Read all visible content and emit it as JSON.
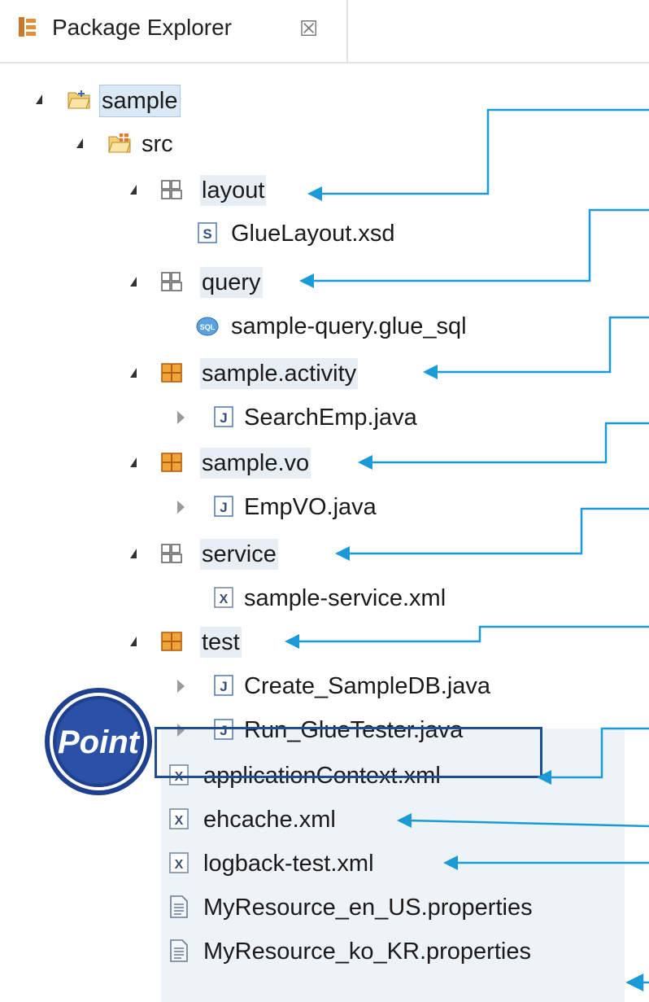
{
  "panel": {
    "title": "Package Explorer",
    "close_glyph": "☒"
  },
  "tree": [
    {
      "label": "sample",
      "icon": "project-folder-icon",
      "toggle": "open"
    },
    {
      "label": "src",
      "icon": "source-folder-icon",
      "toggle": "open"
    },
    {
      "label": "layout",
      "icon": "empty-package-icon",
      "toggle": "open"
    },
    {
      "label": "GlueLayout.xsd",
      "icon": "xsd-file-icon",
      "toggle": "none"
    },
    {
      "label": "query",
      "icon": "empty-package-icon",
      "toggle": "open"
    },
    {
      "label": "sample-query.glue_sql",
      "icon": "sql-file-icon",
      "toggle": "none"
    },
    {
      "label": "sample.activity",
      "icon": "package-icon",
      "toggle": "open"
    },
    {
      "label": "SearchEmp.java",
      "icon": "java-file-icon",
      "toggle": "closed"
    },
    {
      "label": "sample.vo",
      "icon": "package-icon",
      "toggle": "open"
    },
    {
      "label": "EmpVO.java",
      "icon": "java-file-icon",
      "toggle": "closed"
    },
    {
      "label": "service",
      "icon": "empty-package-icon",
      "toggle": "open"
    },
    {
      "label": "sample-service.xml",
      "icon": "xml-file-icon",
      "toggle": "none"
    },
    {
      "label": "test",
      "icon": "package-icon",
      "toggle": "open"
    },
    {
      "label": "Create_SampleDB.java",
      "icon": "java-file-icon",
      "toggle": "closed"
    },
    {
      "label": "Run_GlueTester.java",
      "icon": "java-file-icon",
      "toggle": "closed"
    },
    {
      "label": "applicationContext.xml",
      "icon": "xml-file-icon",
      "toggle": "none"
    },
    {
      "label": "ehcache.xml",
      "icon": "xml-file-icon",
      "toggle": "none"
    },
    {
      "label": "logback-test.xml",
      "icon": "xml-file-icon",
      "toggle": "none"
    },
    {
      "label": "MyResource_en_US.properties",
      "icon": "properties-file-icon",
      "toggle": "none"
    },
    {
      "label": "MyResource_ko_KR.properties",
      "icon": "properties-file-icon",
      "toggle": "none"
    }
  ],
  "badge": {
    "text": "Point"
  },
  "colors": {
    "arrow": "#1a9ad6",
    "highlight_box": "#1f4e93",
    "badge": "#1f3f8f"
  }
}
